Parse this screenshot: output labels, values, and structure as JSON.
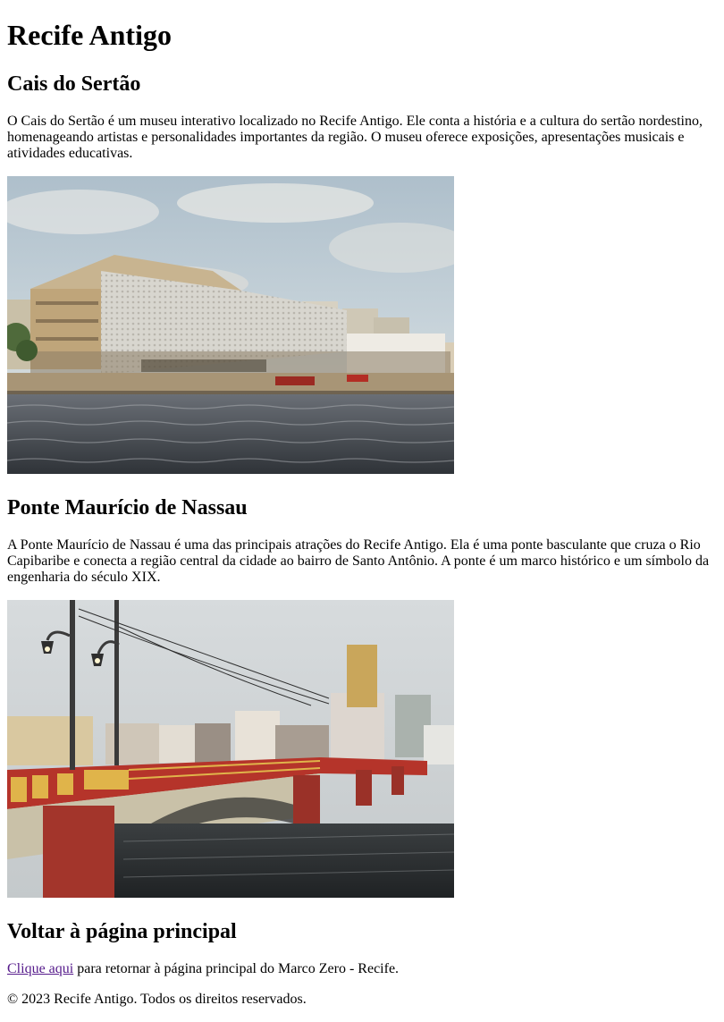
{
  "page": {
    "title": "Recife Antigo"
  },
  "sections": [
    {
      "heading": "Cais do Sertão",
      "text": "O Cais do Sertão é um museu interativo localizado no Recife Antigo. Ele conta a história e a cultura do sertão nordestino, homenageando artistas e personalidades importantes da região. O museu oferece exposições, apresentações musicais e atividades educativas.",
      "image_alt": "Cais do Sertão"
    },
    {
      "heading": "Ponte Maurício de Nassau",
      "text": "A Ponte Maurício de Nassau é uma das principais atrações do Recife Antigo. Ela é uma ponte basculante que cruza o Rio Capibaribe e conecta a região central da cidade ao bairro de Santo Antônio. A ponte é um marco histórico e um símbolo da engenharia do século XIX.",
      "image_alt": "Ponte Maurício de Nassau"
    },
    {
      "heading": "Voltar à página principal",
      "link_text": "Clique aqui",
      "text_after_link": " para retornar à página principal do Marco Zero - Recife."
    }
  ],
  "footer": {
    "text": "© 2023 Recife Antigo. Todos os direitos reservados."
  }
}
